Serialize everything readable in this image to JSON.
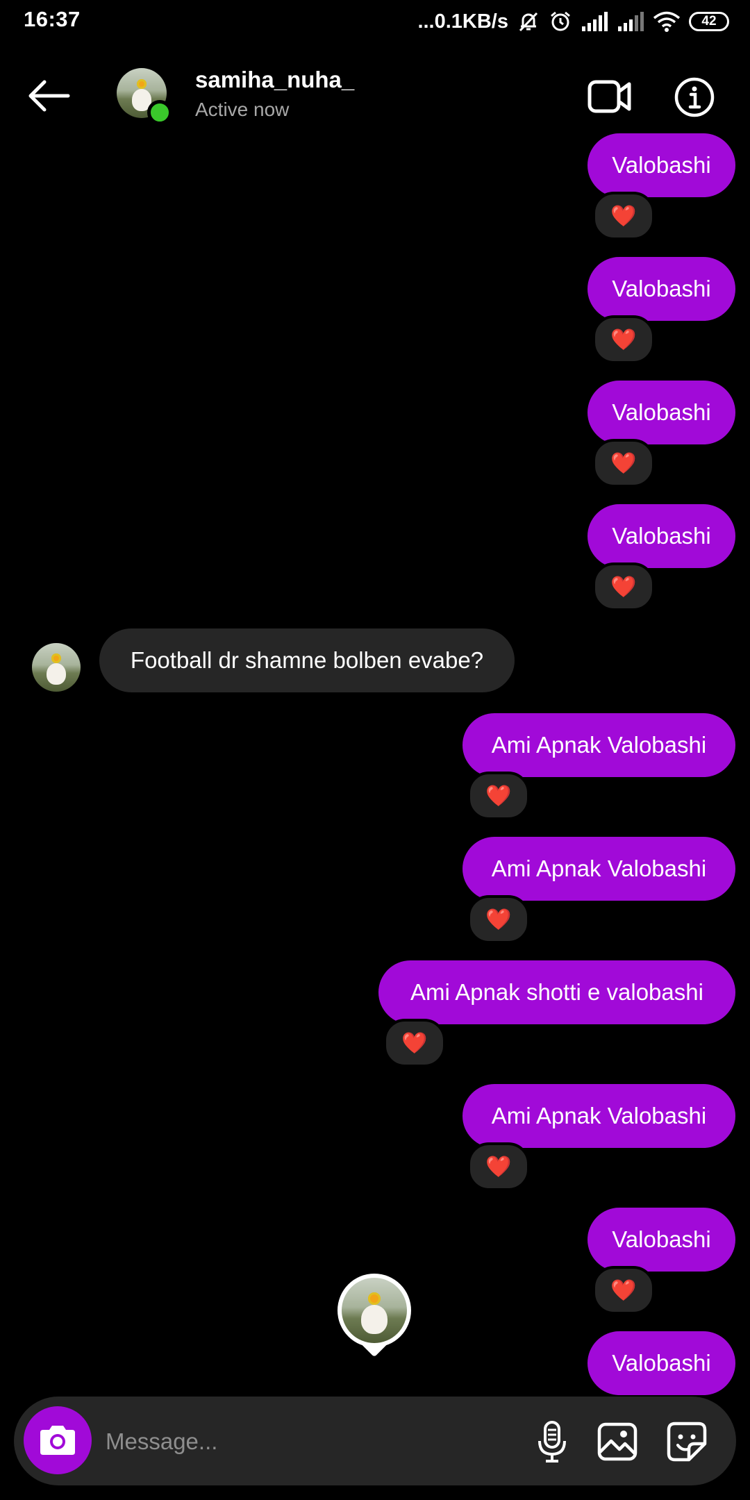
{
  "status_bar": {
    "time": "16:37",
    "network_speed": "...0.1KB/s",
    "battery": "42"
  },
  "header": {
    "username": "samiha_nuha_",
    "status": "Active now"
  },
  "messages": [
    {
      "direction": "outgoing",
      "text": "Valobashi",
      "reaction": "❤️"
    },
    {
      "direction": "outgoing",
      "text": "Valobashi",
      "reaction": "❤️"
    },
    {
      "direction": "outgoing",
      "text": "Valobashi",
      "reaction": "❤️"
    },
    {
      "direction": "outgoing",
      "text": "Valobashi",
      "reaction": "❤️"
    },
    {
      "direction": "incoming",
      "text": "Football dr shamne bolben evabe?"
    },
    {
      "direction": "outgoing",
      "text": "Ami Apnak Valobashi",
      "reaction": "❤️"
    },
    {
      "direction": "outgoing",
      "text": "Ami Apnak Valobashi",
      "reaction": "❤️"
    },
    {
      "direction": "outgoing",
      "text": "Ami Apnak shotti e valobashi",
      "reaction": "❤️"
    },
    {
      "direction": "outgoing",
      "text": "Ami Apnak Valobashi",
      "reaction": "❤️"
    },
    {
      "direction": "outgoing",
      "text": "Valobashi",
      "reaction": "❤️"
    },
    {
      "direction": "outgoing",
      "text": "Valobashi"
    }
  ],
  "composer": {
    "placeholder": "Message..."
  },
  "colors": {
    "background": "#000000",
    "outgoing_bubble": "#a10ad8",
    "incoming_bubble": "#262626",
    "online": "#3ac92b",
    "reaction_heart": "#e0242a"
  },
  "icons": [
    "back-arrow-icon",
    "video-call-icon",
    "info-icon",
    "camera-icon",
    "microphone-icon",
    "gallery-icon",
    "sticker-icon",
    "heart-icon"
  ]
}
